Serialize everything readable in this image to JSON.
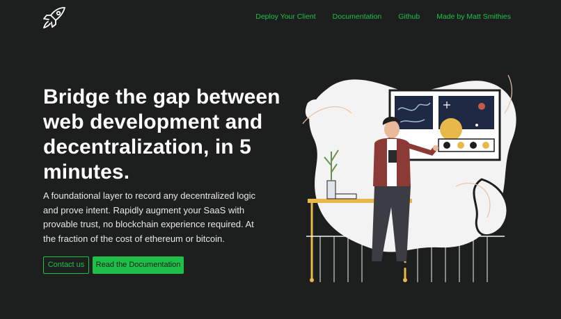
{
  "header": {
    "logo_icon": "rocket-icon",
    "nav": [
      {
        "label": "Deploy Your Client"
      },
      {
        "label": "Documentation"
      },
      {
        "label": "Github"
      },
      {
        "label": "Made by Matt Smithies"
      }
    ]
  },
  "hero": {
    "title": "Bridge the gap between web development and decentralization, in 5 minutes.",
    "description": "A foundational layer to record any decentralized logic and prove intent. Rapidly augment your SaaS with provable trust, no blockchain experience required. At the fraction of the cost of ethereum or bitcoin.",
    "buttons": {
      "contact": "Contact us",
      "docs": "Read the Documentation"
    }
  },
  "colors": {
    "background": "#1c1f1e",
    "accent": "#1fc04a",
    "text": "#ffffff"
  }
}
